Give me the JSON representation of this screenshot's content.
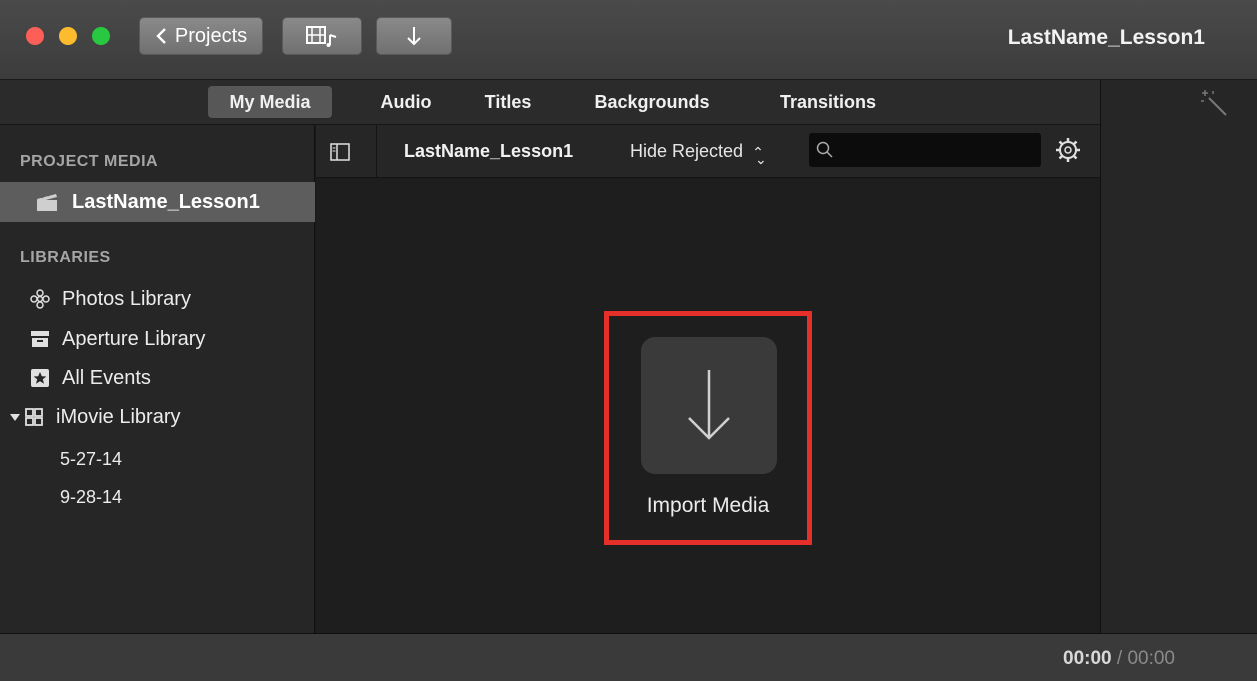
{
  "window": {
    "title": "LastName_Lesson1"
  },
  "toolbar": {
    "projects_label": "Projects",
    "media_icon": "film-music-icon",
    "import_icon": "download-arrow-icon"
  },
  "tabs": [
    {
      "label": "My Media",
      "active": true
    },
    {
      "label": "Audio",
      "active": false
    },
    {
      "label": "Titles",
      "active": false
    },
    {
      "label": "Backgrounds",
      "active": false
    },
    {
      "label": "Transitions",
      "active": false
    }
  ],
  "sidebar": {
    "project_media_heading": "PROJECT MEDIA",
    "project_item": "LastName_Lesson1",
    "libraries_heading": "LIBRARIES",
    "libraries": [
      {
        "label": "Photos Library",
        "icon": "flower-icon"
      },
      {
        "label": "Aperture Library",
        "icon": "aperture-box-icon"
      },
      {
        "label": "All Events",
        "icon": "star-box-icon"
      },
      {
        "label": "iMovie Library",
        "icon": "grid-icon"
      }
    ],
    "events": [
      "5-27-14",
      "9-28-14"
    ]
  },
  "media_toolbar": {
    "library_name": "LastName_Lesson1",
    "filter_label": "Hide Rejected",
    "search_placeholder": ""
  },
  "main": {
    "import_label": "Import Media",
    "highlight_color": "#e5302a"
  },
  "footer": {
    "current_time": "00:00",
    "separator": "/",
    "total_time": "00:00"
  }
}
